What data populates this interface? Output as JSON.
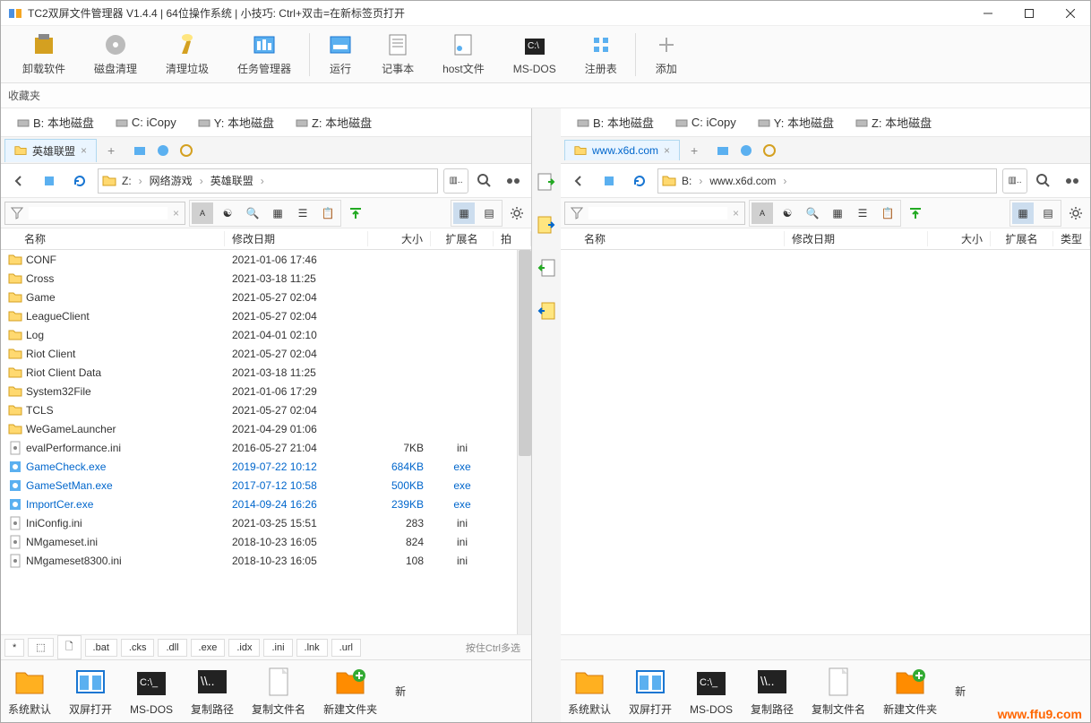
{
  "title": "TC2双屏文件管理器 V1.4.4  |  64位操作系统 | 小技巧: Ctrl+双击=在新标签页打开",
  "topbar": [
    {
      "label": "卸载软件",
      "icon": "uninstall"
    },
    {
      "label": "磁盘清理",
      "icon": "disk-clean"
    },
    {
      "label": "清理垃圾",
      "icon": "brush"
    },
    {
      "label": "任务管理器",
      "icon": "taskmgr"
    },
    {
      "sep": true
    },
    {
      "label": "运行",
      "icon": "run"
    },
    {
      "label": "记事本",
      "icon": "notepad"
    },
    {
      "label": "host文件",
      "icon": "host"
    },
    {
      "label": "MS-DOS",
      "icon": "dos"
    },
    {
      "label": "注册表",
      "icon": "regedit"
    },
    {
      "sep": true
    },
    {
      "label": "添加",
      "icon": "plus"
    }
  ],
  "favLabel": "收藏夹",
  "drives": [
    {
      "label": "B: 本地磁盘"
    },
    {
      "label": "C: iCopy"
    },
    {
      "label": "Y: 本地磁盘"
    },
    {
      "label": "Z: 本地磁盘"
    }
  ],
  "left": {
    "tab": "英雄联盟",
    "breadcrumb": [
      "Z:",
      "网络游戏",
      "英雄联盟"
    ],
    "columns": {
      "name": "名称",
      "date": "修改日期",
      "size": "大小",
      "ext": "扩展名",
      "attr": "拍"
    },
    "files": [
      {
        "name": "CONF",
        "date": "2021-01-06 17:46",
        "size": "",
        "ext": "",
        "type": "folder"
      },
      {
        "name": "Cross",
        "date": "2021-03-18 11:25",
        "size": "",
        "ext": "",
        "type": "folder"
      },
      {
        "name": "Game",
        "date": "2021-05-27 02:04",
        "size": "",
        "ext": "",
        "type": "folder"
      },
      {
        "name": "LeagueClient",
        "date": "2021-05-27 02:04",
        "size": "",
        "ext": "",
        "type": "folder"
      },
      {
        "name": "Log",
        "date": "2021-04-01 02:10",
        "size": "",
        "ext": "",
        "type": "folder"
      },
      {
        "name": "Riot Client",
        "date": "2021-05-27 02:04",
        "size": "",
        "ext": "",
        "type": "folder"
      },
      {
        "name": "Riot Client Data",
        "date": "2021-03-18 11:25",
        "size": "",
        "ext": "",
        "type": "folder"
      },
      {
        "name": "System32File",
        "date": "2021-01-06 17:29",
        "size": "",
        "ext": "",
        "type": "folder"
      },
      {
        "name": "TCLS",
        "date": "2021-05-27 02:04",
        "size": "",
        "ext": "",
        "type": "folder"
      },
      {
        "name": "WeGameLauncher",
        "date": "2021-04-29 01:06",
        "size": "",
        "ext": "",
        "type": "folder"
      },
      {
        "name": "evalPerformance.ini",
        "date": "2016-05-27 21:04",
        "size": "7KB",
        "ext": "ini",
        "type": "ini"
      },
      {
        "name": "GameCheck.exe",
        "date": "2019-07-22 10:12",
        "size": "684KB",
        "ext": "exe",
        "type": "exe"
      },
      {
        "name": "GameSetMan.exe",
        "date": "2017-07-12 10:58",
        "size": "500KB",
        "ext": "exe",
        "type": "exe"
      },
      {
        "name": "ImportCer.exe",
        "date": "2014-09-24 16:26",
        "size": "239KB",
        "ext": "exe",
        "type": "exe"
      },
      {
        "name": "IniConfig.ini",
        "date": "2021-03-25 15:51",
        "size": "283",
        "ext": "ini",
        "type": "ini"
      },
      {
        "name": "NMgameset.ini",
        "date": "2018-10-23 16:05",
        "size": "824",
        "ext": "ini",
        "type": "ini"
      },
      {
        "name": "NMgameset8300.ini",
        "date": "2018-10-23 16:05",
        "size": "108",
        "ext": "ini",
        "type": "ini"
      }
    ],
    "ext_filters": [
      "*",
      "⬚",
      "🗋",
      ".bat",
      ".cks",
      ".dll",
      ".exe",
      ".idx",
      ".ini",
      ".lnk",
      ".url"
    ],
    "ext_hint": "按住Ctrl多选"
  },
  "right": {
    "tab": "www.x6d.com",
    "breadcrumb": [
      "B:",
      "www.x6d.com"
    ],
    "columns": {
      "name": "名称",
      "date": "修改日期",
      "size": "大小",
      "ext": "扩展名",
      "attr": "类型"
    },
    "files": []
  },
  "bottombar": [
    {
      "label": "系统默认",
      "icon": "folder"
    },
    {
      "label": "双屏打开",
      "icon": "dual"
    },
    {
      "label": "MS-DOS",
      "icon": "dos"
    },
    {
      "label": "复制路径",
      "icon": "copypath"
    },
    {
      "label": "复制文件名",
      "icon": "copyname"
    },
    {
      "label": "新建文件夹",
      "icon": "newfolder"
    },
    {
      "label": "新",
      "icon": "",
      "cut": true
    }
  ],
  "watermark": "www.ffu9.com"
}
